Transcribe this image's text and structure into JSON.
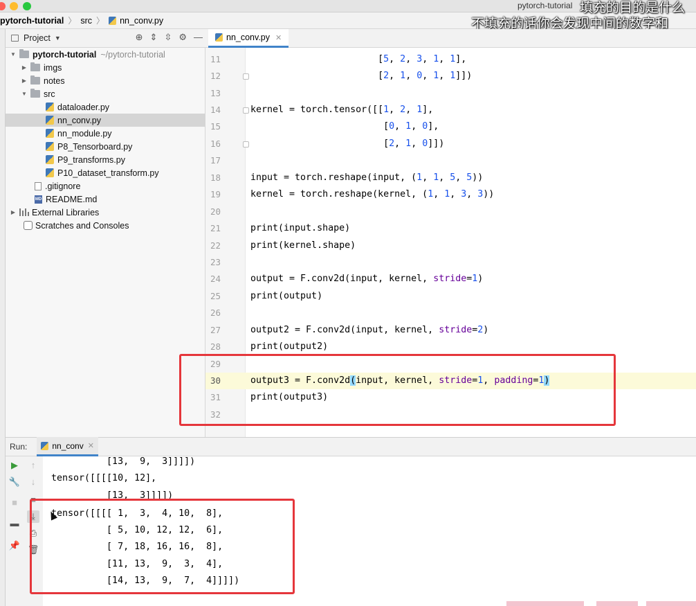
{
  "window": {
    "title": "pytorch-tutorial",
    "subtitle_line1": "填充的目的是什么",
    "subtitle_line2": "不填充的话你会发现中间的数字和"
  },
  "breadcrumb": {
    "project": "pytorch-tutorial",
    "folder": "src",
    "file": "nn_conv.py"
  },
  "project_panel": {
    "title": "Project",
    "tree": [
      {
        "label": "pytorch-tutorial",
        "path": "~/pytorch-tutorial",
        "type": "folder",
        "expanded": true
      },
      {
        "label": "imgs",
        "type": "folder",
        "expanded": false
      },
      {
        "label": "notes",
        "type": "folder",
        "expanded": false
      },
      {
        "label": "src",
        "type": "folder",
        "expanded": true
      },
      {
        "label": "dataloader.py",
        "type": "python-file"
      },
      {
        "label": "nn_conv.py",
        "type": "python-file",
        "selected": true
      },
      {
        "label": "nn_module.py",
        "type": "python-file"
      },
      {
        "label": "P8_Tensorboard.py",
        "type": "python-file"
      },
      {
        "label": "P9_transforms.py",
        "type": "python-file"
      },
      {
        "label": "P10_dataset_transform.py",
        "type": "python-file"
      },
      {
        "label": ".gitignore",
        "type": "file"
      },
      {
        "label": "README.md",
        "type": "markdown-file"
      },
      {
        "label": "External Libraries",
        "type": "library",
        "expanded": false
      },
      {
        "label": "Scratches and Consoles",
        "type": "scratch"
      }
    ]
  },
  "editor": {
    "tab_label": "nn_conv.py",
    "current_line": 30,
    "lines": [
      {
        "no": "11",
        "code": "                       [5, 2, 3, 1, 1],"
      },
      {
        "no": "12",
        "code": "                       [2, 1, 0, 1, 1]])"
      },
      {
        "no": "13",
        "code": ""
      },
      {
        "no": "14",
        "code": "kernel = torch.tensor([[1, 2, 1],"
      },
      {
        "no": "15",
        "code": "                        [0, 1, 0],"
      },
      {
        "no": "16",
        "code": "                        [2, 1, 0]])"
      },
      {
        "no": "17",
        "code": ""
      },
      {
        "no": "18",
        "code": "input = torch.reshape(input, (1, 1, 5, 5))"
      },
      {
        "no": "19",
        "code": "kernel = torch.reshape(kernel, (1, 1, 3, 3))"
      },
      {
        "no": "20",
        "code": ""
      },
      {
        "no": "21",
        "code": "print(input.shape)"
      },
      {
        "no": "22",
        "code": "print(kernel.shape)"
      },
      {
        "no": "23",
        "code": ""
      },
      {
        "no": "24",
        "code": "output = F.conv2d(input, kernel, stride=1)"
      },
      {
        "no": "25",
        "code": "print(output)"
      },
      {
        "no": "26",
        "code": ""
      },
      {
        "no": "27",
        "code": "output2 = F.conv2d(input, kernel, stride=2)"
      },
      {
        "no": "28",
        "code": "print(output2)"
      },
      {
        "no": "29",
        "code": ""
      },
      {
        "no": "30",
        "code": "output3 = F.conv2d(input, kernel, stride=1, padding=1)"
      },
      {
        "no": "31",
        "code": "print(output3)"
      },
      {
        "no": "32",
        "code": ""
      }
    ]
  },
  "run_panel": {
    "label": "Run:",
    "tab_label": "nn_conv",
    "console_lines": [
      "          [13,  9,  3]]]])",
      "tensor([[[[10, 12],",
      "          [13,  3]]]])",
      "tensor([[[[ 1,  3,  4, 10,  8],",
      "          [ 5, 10, 12, 12,  6],",
      "          [ 7, 18, 16, 16,  8],",
      "          [11, 13,  9,  3,  4],",
      "          [14, 13,  9,  7,  4]]]])"
    ]
  },
  "colors": {
    "accent_tab": "#4083c9",
    "number": "#1750eb",
    "keyword_arg": "#660099",
    "highlight_box": "#e5363b",
    "current_line": "#fcfad9"
  }
}
